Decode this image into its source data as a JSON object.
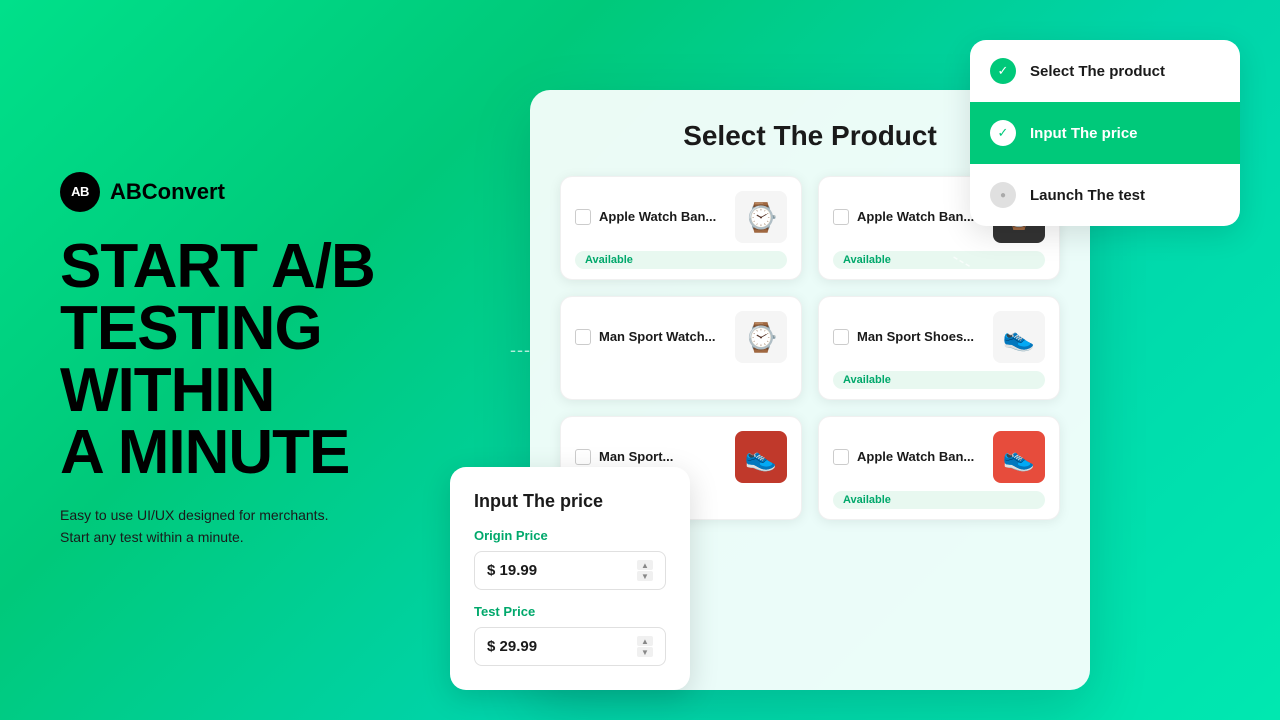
{
  "logo": {
    "icon": "AB",
    "name": "ABConvert"
  },
  "hero": {
    "title": "START A/B\nTESTING\nWITHIN\nA MINUTE",
    "subtitle": "Easy to use UI/UX designed for merchants.\nStart any test within a minute."
  },
  "card": {
    "title": "Select The  Product"
  },
  "products": [
    {
      "name": "Apple Watch Ban...",
      "available": "Available",
      "emoji": "⌚",
      "checked": false
    },
    {
      "name": "Apple Watch Ban...",
      "available": "Available",
      "emoji": "⌚",
      "checked": false
    },
    {
      "name": "Man Sport Watch...",
      "available": null,
      "emoji": "⌚",
      "checked": false
    },
    {
      "name": "Man Sport Shoes...",
      "available": "Available",
      "emoji": "👟",
      "checked": false
    },
    {
      "name": "Man Sport...",
      "available": null,
      "emoji": "👟",
      "checked": false
    },
    {
      "name": "Apple Watch Ban...",
      "available": "Available",
      "emoji": "👟",
      "checked": false
    }
  ],
  "steps": [
    {
      "label": "Select The product",
      "state": "done"
    },
    {
      "label": "Input The price",
      "state": "active"
    },
    {
      "label": "Launch The test",
      "state": "pending"
    }
  ],
  "price_card": {
    "title": "Input The price",
    "origin_label": "Origin Price",
    "origin_value": "$ 19.99",
    "test_label": "Test Price",
    "test_value": "$ 29.99"
  }
}
